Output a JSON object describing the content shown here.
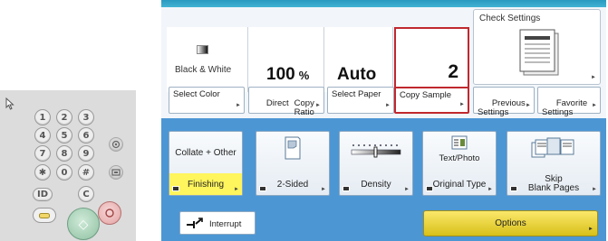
{
  "keypad": {
    "keys": [
      "1",
      "2",
      "3",
      "4",
      "5",
      "6",
      "7",
      "8",
      "9",
      "✱",
      "0",
      "#"
    ],
    "id_label": "ID",
    "clear_label": "C",
    "start_glyph": "◇"
  },
  "screen": {
    "status": {
      "color_mode": "Black & White",
      "ratio_value": "100",
      "ratio_unit": "%",
      "paper": "Auto",
      "copies": "2"
    },
    "check_settings": "Check Settings",
    "setting_buttons": [
      {
        "label": "Select Color"
      },
      {
        "label": "Direct"
      },
      {
        "label": "Copy\nRatio"
      },
      {
        "label": "Select Paper"
      },
      {
        "label": "Copy Sample"
      },
      {
        "label": "Previous\nSettings"
      },
      {
        "label": "Favorite\nSettings"
      }
    ],
    "function_tiles": [
      {
        "label": "Finishing",
        "top_label": "Collate + Other",
        "highlight": true
      },
      {
        "label": "2-Sided"
      },
      {
        "label": "Density"
      },
      {
        "label": "Original Type",
        "top_label": "Text/Photo"
      },
      {
        "label": "Skip\nBlank Pages"
      }
    ],
    "interrupt": "Interrupt",
    "options": "Options"
  },
  "colors": {
    "screen_blue": "#4c96d4",
    "highlight_red": "#c0282e",
    "active_yellow": "#fff55c"
  }
}
